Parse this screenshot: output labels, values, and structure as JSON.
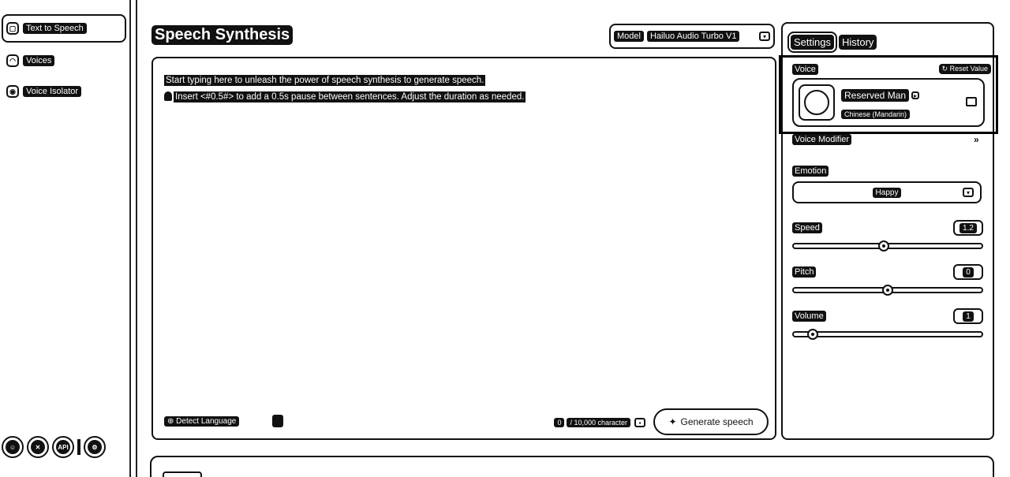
{
  "sidebar": {
    "items": [
      {
        "label": "Text to Speech",
        "icon": "speech-bubble-icon"
      },
      {
        "label": "Voices",
        "icon": "voices-icon"
      },
      {
        "label": "Voice Isolator",
        "icon": "isolator-icon"
      }
    ],
    "footer_icons": [
      "discord-icon",
      "x-icon",
      "api-icon",
      "settings-icon"
    ],
    "api_label": "API"
  },
  "main": {
    "title": "Speech Synthesis",
    "model_label": "Model",
    "model_value": "Hailuo Audio Turbo V1",
    "editor": {
      "line1": "Start typing here to unleash the power of speech synthesis to generate speech.",
      "line2": "Insert <#0.5#> to add a 0.5s pause between sentences. Adjust the duration as needed."
    },
    "detect_language": "Detect Language",
    "char_count_current": "0",
    "char_count_label": "/ 10,000 character",
    "generate_label": "Generate speech"
  },
  "panel": {
    "tabs": [
      "Settings",
      "History"
    ],
    "voice_label": "Voice",
    "reset_label": "Reset Value",
    "voice_name": "Reserved Man",
    "voice_language": "Chinese (Mandarin)",
    "voice_modifier_label": "Voice Modifier",
    "emotion_label": "Emotion",
    "emotion_value": "Happy",
    "speed_label": "Speed",
    "speed_value": "1.2",
    "speed_fraction": 0.48,
    "pitch_label": "Pitch",
    "pitch_value": "0",
    "pitch_fraction": 0.5,
    "volume_label": "Volume",
    "volume_value": "1",
    "volume_fraction": 0.1
  }
}
